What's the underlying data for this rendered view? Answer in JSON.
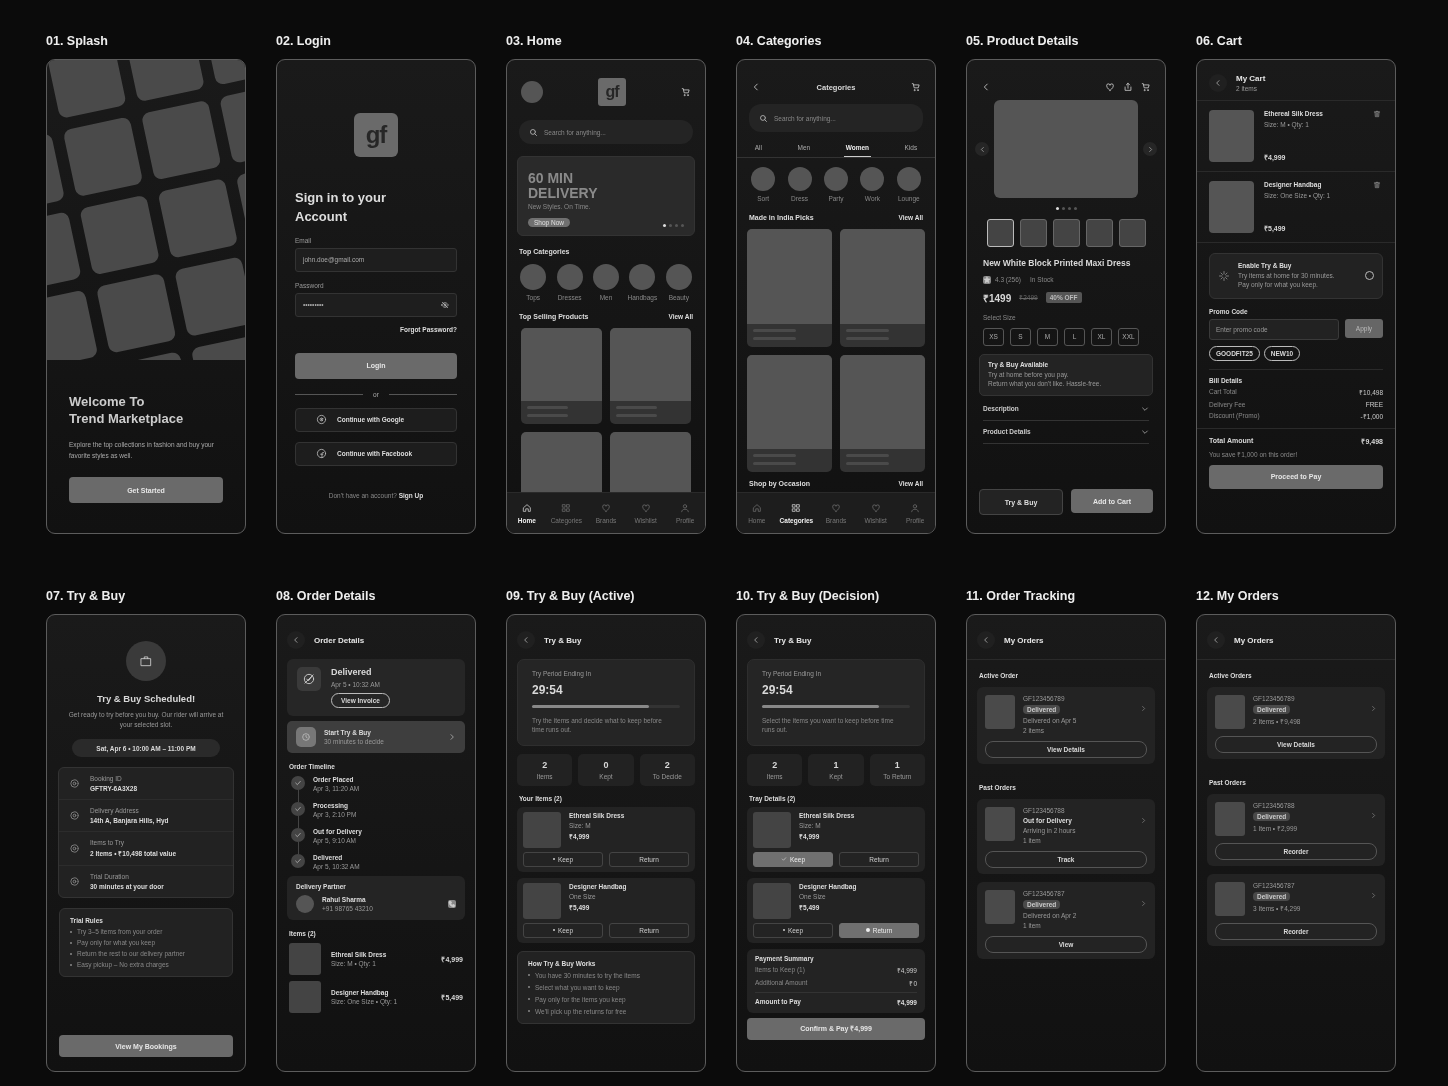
{
  "screens": [
    {
      "kind": "splash",
      "title": "01. Splash",
      "heading": "Welcome To\nTrend Marketplace",
      "body": "Explore the top collections in fashion and buy your favorite styles as well.",
      "button": "Get Started"
    },
    {
      "kind": "login",
      "title": "02. Login",
      "logo": "gf",
      "heading": "Sign in to your\nAccount",
      "fields": [
        {
          "label": "Email",
          "value": "john.doe@gmail.com",
          "masked": false
        },
        {
          "label": "Password",
          "value": "•••••••••",
          "masked": true
        }
      ],
      "forgot": "Forgot Password?",
      "button": "Login",
      "divider": "or",
      "social": [
        {
          "kind": "google",
          "label": "Continue with Google"
        },
        {
          "kind": "facebook",
          "label": "Continue with Facebook"
        }
      ],
      "footer": "Don't have an account?",
      "footer_link": "Sign Up"
    },
    {
      "kind": "home",
      "title": "03. Home",
      "logo": "gf",
      "search": "Search for anything...",
      "banner": {
        "title": "60 MIN\nDELIVERY",
        "subtitle": "New Styles. On Time.",
        "button": "Shop Now",
        "dots": [
          {
            "selected": true
          },
          {
            "selected": false
          },
          {
            "selected": false
          },
          {
            "selected": false
          }
        ]
      },
      "categories_title": "Top Categories",
      "categories": [
        "Tops",
        "Dresses",
        "Men",
        "Handbags",
        "Beauty"
      ],
      "products_title": "Top Selling Products",
      "products_link": "View All",
      "nav": [
        {
          "label": "Home",
          "selected": true
        },
        {
          "label": "Categories",
          "selected": false
        },
        {
          "label": "Brands",
          "selected": false
        },
        {
          "label": "Wishlist",
          "selected": false
        },
        {
          "label": "Profile",
          "selected": false
        }
      ]
    },
    {
      "kind": "categories",
      "title": "04. Categories",
      "heading": "Categories",
      "search": "Search for anything...",
      "tabs": [
        {
          "label": "All",
          "selected": false
        },
        {
          "label": "Men",
          "selected": false
        },
        {
          "label": "Women",
          "selected": true
        },
        {
          "label": "Kids",
          "selected": false
        }
      ],
      "circles": [
        "Sort",
        "Dress",
        "Party",
        "Work",
        "Lounge"
      ],
      "sections": [
        {
          "title": "Made in India Picks",
          "link": "View All"
        },
        {
          "title": "Shop by Occasion",
          "link": "View All"
        }
      ],
      "nav": [
        {
          "label": "Home",
          "selected": false
        },
        {
          "label": "Categories",
          "selected": true
        },
        {
          "label": "Brands",
          "selected": false
        },
        {
          "label": "Wishlist",
          "selected": false
        },
        {
          "label": "Profile",
          "selected": false
        }
      ]
    },
    {
      "kind": "product",
      "title": "05. Product Details",
      "dots": [
        {
          "selected": true
        },
        {
          "selected": false
        },
        {
          "selected": false
        },
        {
          "selected": false
        }
      ],
      "thumbs": [
        {
          "selected": true
        },
        {
          "selected": false
        },
        {
          "selected": false
        },
        {
          "selected": false
        },
        {
          "selected": false
        }
      ],
      "name": "New White Block Printed Maxi Dress",
      "rating": "4.3 (256)",
      "stock": "In Stock",
      "price": "₹1499",
      "old_price": "₹2499",
      "discount": "40% OFF",
      "size_label": "Select Size",
      "sizes": [
        {
          "label": "XS",
          "selected": false
        },
        {
          "label": "S",
          "selected": false
        },
        {
          "label": "M",
          "selected": false
        },
        {
          "label": "L",
          "selected": false
        },
        {
          "label": "XL",
          "selected": false
        },
        {
          "label": "XXL",
          "selected": false
        }
      ],
      "notice": {
        "title": "Try & Buy Available",
        "text": "Try at home before you pay.\nReturn what you don't like. Hassle-free."
      },
      "accordions": [
        {
          "label": "Description",
          "expanded": false
        },
        {
          "label": "Product Details",
          "expanded": false
        }
      ],
      "actions": [
        {
          "label": "Try & Buy",
          "kind": "secondary"
        },
        {
          "label": "Add to Cart",
          "kind": "primary"
        }
      ]
    },
    {
      "kind": "cart",
      "title": "06. Cart",
      "heading": "My Cart",
      "subheading": "2 items",
      "items": [
        {
          "name": "Ethereal Silk Dress",
          "meta": "Size: M • Qty: 1",
          "price": "₹4,999"
        },
        {
          "name": "Designer Handbag",
          "meta": "Size: One Size • Qty: 1",
          "price": "₹5,499"
        }
      ],
      "try_buy": {
        "title": "Enable Try & Buy",
        "text": "Try items at home for 30 minutes.\nPay only for what you keep.",
        "on": false
      },
      "promo": {
        "label": "Promo Code",
        "placeholder": "Enter promo code",
        "button": "Apply",
        "codes": [
          "GOODFIT25",
          "NEW10"
        ]
      },
      "bill": {
        "title": "Bill Details",
        "rows": [
          {
            "label": "Cart Total",
            "value": "₹10,498"
          },
          {
            "label": "Delivery Fee",
            "value": "FREE"
          },
          {
            "label": "Discount (Promo)",
            "value": "-₹1,000"
          }
        ]
      },
      "total": {
        "label": "Total Amount",
        "value": "₹9,498"
      },
      "savings": "You save ₹1,000 on this order!",
      "button": "Proceed to Pay"
    },
    {
      "kind": "scheduled",
      "title": "07. Try & Buy",
      "heading": "Try & Buy Scheduled!",
      "text": "Get ready to try before you buy. Our rider will arrive at your selected slot.",
      "slot": "Sat, Apr 6 • 10:00 AM – 11:00 PM",
      "details": [
        {
          "label": "Booking ID",
          "value": "GFTRY-6A3X28"
        },
        {
          "label": "Delivery Address",
          "value": "14th A, Banjara Hills, Hyd"
        },
        {
          "label": "Items to Try",
          "value": "2 Items • ₹10,498 total value"
        },
        {
          "label": "Trial Duration",
          "value": "30 minutes at your door"
        }
      ],
      "rules": {
        "title": "Trial Rules",
        "items": [
          "Try 3–5 items from your order",
          "Pay only for what you keep",
          "Return the rest to our delivery partner",
          "Easy pickup – No extra charges"
        ]
      },
      "button": "View My Bookings"
    },
    {
      "kind": "order_details",
      "title": "08. Order Details",
      "heading": "Order Details",
      "status": {
        "title": "Delivered",
        "time": "Apr 5 • 10:32 AM",
        "button": "View Invoice"
      },
      "action": {
        "title": "Start Try & Buy",
        "text": "30 minutes to decide"
      },
      "timeline_title": "Order Timeline",
      "timeline": [
        {
          "title": "Order Placed",
          "time": "Apr 3, 11:20 AM",
          "done": true
        },
        {
          "title": "Processing",
          "time": "Apr 3, 2:10 PM",
          "done": true
        },
        {
          "title": "Out for Delivery",
          "time": "Apr 5, 9:10 AM",
          "done": true
        },
        {
          "title": "Delivered",
          "time": "Apr 5, 10:32 AM",
          "done": true
        }
      ],
      "partner": {
        "label": "Delivery Partner",
        "name": "Rahul Sharma",
        "phone": "+91 98765 43210"
      },
      "items_title": "Items (2)",
      "items": [
        {
          "name": "Ethreal Silk Dress",
          "meta": "Size: M • Qty: 1",
          "price": "₹4,999"
        },
        {
          "name": "Designer Handbag",
          "meta": "Size: One Size • Qty: 1",
          "price": "₹5,499"
        }
      ]
    },
    {
      "kind": "trial",
      "title": "09. Try & Buy (Active)",
      "heading": "Try & Buy",
      "timer": {
        "label": "Try Period Ending In",
        "time": "29:54",
        "level": 0.79,
        "text": "Try the items and decide what to keep before time runs out."
      },
      "stats": [
        {
          "value": "2",
          "label": "Items"
        },
        {
          "value": "0",
          "label": "Kept"
        },
        {
          "value": "2",
          "label": "To Decide"
        }
      ],
      "items_title": "Your Items (2)",
      "items": [
        {
          "name": "Ethreal Silk Dress",
          "meta": "Size: M",
          "price": "₹4,999",
          "actions": [
            {
              "kind": "keep",
              "label": "Keep",
              "selected": false
            },
            {
              "kind": "return",
              "label": "Return",
              "selected": false
            }
          ]
        },
        {
          "name": "Designer Handbag",
          "meta": "One Size",
          "price": "₹5,499",
          "actions": [
            {
              "kind": "keep",
              "label": "Keep",
              "selected": false
            },
            {
              "kind": "return",
              "label": "Return",
              "selected": false
            }
          ]
        }
      ],
      "how": {
        "title": "How Try & Buy Works",
        "items": [
          "You have 30 minutes to try the items",
          "Select what you want to keep",
          "Pay only for the items you keep",
          "We'll pick up the returns for free"
        ]
      }
    },
    {
      "kind": "trial",
      "title": "10. Try & Buy (Decision)",
      "heading": "Try & Buy",
      "timer": {
        "label": "Try Period Ending In",
        "time": "29:54",
        "level": 0.79,
        "text": "Select the items you want to keep before time runs out."
      },
      "stats": [
        {
          "value": "2",
          "label": "Items"
        },
        {
          "value": "1",
          "label": "Kept"
        },
        {
          "value": "1",
          "label": "To Return"
        }
      ],
      "items_title": "Tray Details (2)",
      "items": [
        {
          "name": "Ethreal Silk Dress",
          "meta": "Size: M",
          "price": "₹4,999",
          "actions": [
            {
              "kind": "keep",
              "label": "Keep",
              "selected": true
            },
            {
              "kind": "return",
              "label": "Return",
              "selected": false
            }
          ]
        },
        {
          "name": "Designer Handbag",
          "meta": "One Size",
          "price": "₹5,499",
          "actions": [
            {
              "kind": "keep",
              "label": "Keep",
              "selected": false
            },
            {
              "kind": "return",
              "label": "Return",
              "selected": true
            }
          ]
        }
      ],
      "summary": {
        "title": "Payment Summary",
        "rows": [
          {
            "label": "Items to Keep (1)",
            "value": "₹4,999"
          },
          {
            "label": "Additional Amount",
            "value": "₹0"
          }
        ],
        "total": {
          "label": "Amount to Pay",
          "value": "₹4,999"
        }
      },
      "button": "Confirm & Pay ₹4,999"
    },
    {
      "kind": "orders",
      "title": "11. Order Tracking",
      "heading": "My Orders",
      "sections": [
        {
          "title": "Active Order",
          "orders": [
            {
              "id": "GF123456789",
              "status": {
                "label": "Delivered",
                "kind": "badge"
              },
              "lines": [
                "Delivered on Apr 5",
                "2 items"
              ],
              "button": "View Details"
            }
          ]
        },
        {
          "title": "Past Orders",
          "orders": [
            {
              "id": "GF123456788",
              "status": {
                "label": "Out for Delivery",
                "kind": "text"
              },
              "lines": [
                "Arriving in 2 hours",
                "1 item"
              ],
              "button": "Track"
            },
            {
              "id": "GF123456787",
              "status": {
                "label": "Delivered",
                "kind": "badge"
              },
              "lines": [
                "Delivered on Apr 2",
                "1 item"
              ],
              "button": "View"
            }
          ]
        }
      ]
    },
    {
      "kind": "orders",
      "title": "12. My Orders",
      "heading": "My Orders",
      "sections": [
        {
          "title": "Active Orders",
          "orders": [
            {
              "id": "GF123456789",
              "status": {
                "label": "Delivered",
                "kind": "badge"
              },
              "lines": [
                "2 Items • ₹9,498"
              ],
              "button": "View Details"
            }
          ]
        },
        {
          "title": "Past Orders",
          "orders": [
            {
              "id": "GF123456788",
              "status": {
                "label": "Delivered",
                "kind": "badge"
              },
              "lines": [
                "1 Item • ₹2,999"
              ],
              "button": "Reorder"
            },
            {
              "id": "GF123456787",
              "status": {
                "label": "Delivered",
                "kind": "badge"
              },
              "lines": [
                "3 Items • ₹4,299"
              ],
              "button": "Reorder"
            }
          ]
        }
      ]
    }
  ]
}
